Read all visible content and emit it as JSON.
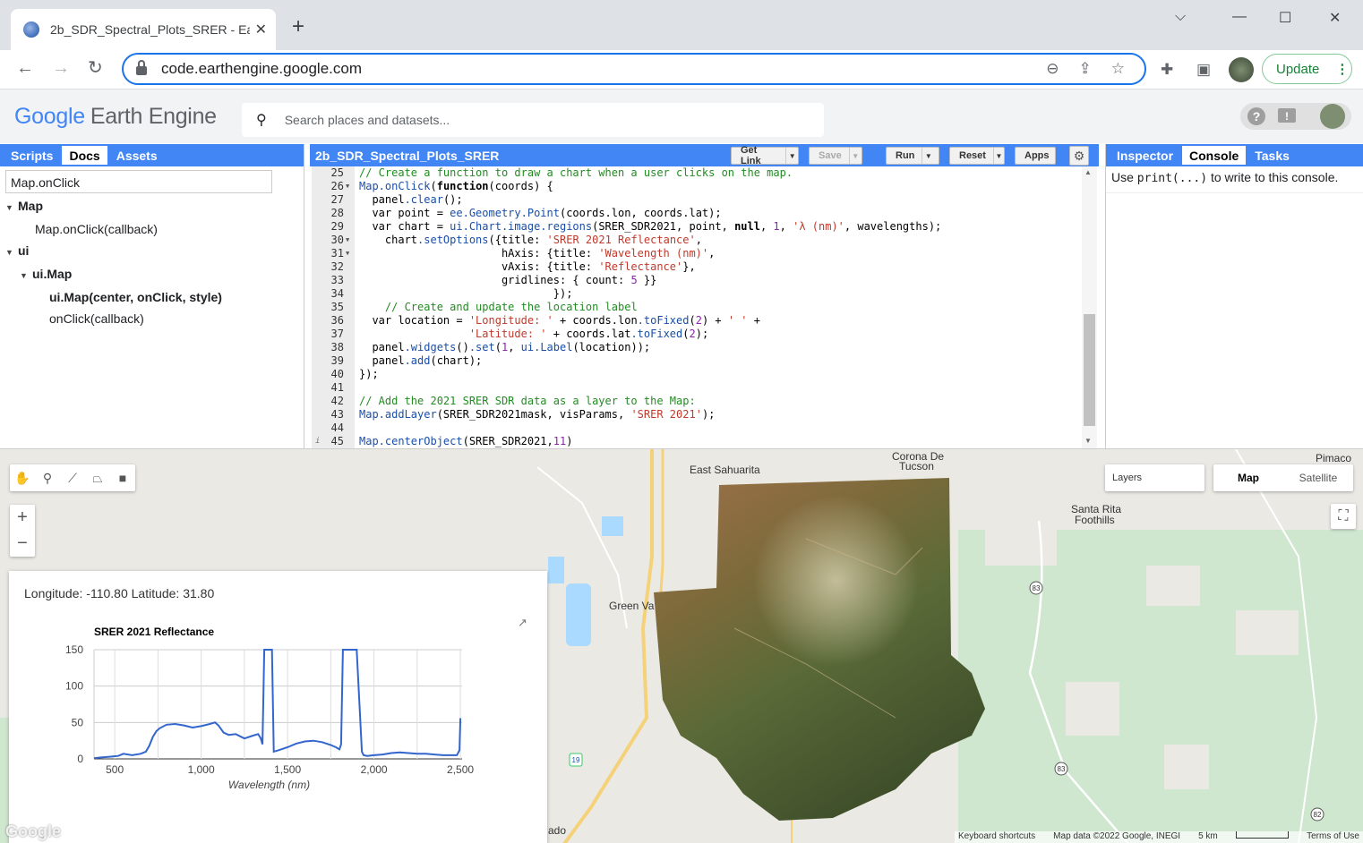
{
  "browser": {
    "tab_title": "2b_SDR_Spectral_Plots_SRER - Ea",
    "url": "code.earthengine.google.com",
    "update_label": "Update"
  },
  "ee": {
    "logo_google": "Google",
    "logo_product": "Earth Engine",
    "search_placeholder": "Search places and datasets..."
  },
  "left_panel": {
    "tabs": [
      "Scripts",
      "Docs",
      "Assets"
    ],
    "active_tab": "Docs",
    "search_value": "Map.onClick",
    "tree": [
      {
        "label": "Map",
        "level": 0,
        "expanded": true,
        "bold": true
      },
      {
        "label": "Map.onClick(callback)",
        "level": 1
      },
      {
        "label": "ui",
        "level": 0,
        "expanded": true,
        "bold": true
      },
      {
        "label": "ui.Map",
        "level": 1,
        "expanded": true,
        "bold": true
      },
      {
        "label": "ui.Map(center, onClick, style)",
        "level": 2,
        "bold": true
      },
      {
        "label": "onClick(callback)",
        "level": 2
      }
    ]
  },
  "editor": {
    "script_name": "2b_SDR_Spectral_Plots_SRER",
    "buttons": [
      "Get Link",
      "Save",
      "Run",
      "Reset",
      "Apps"
    ],
    "lines": [
      {
        "n": "25",
        "code": "// Create a function to draw a chart when a user clicks on the map."
      },
      {
        "n": "26",
        "code": "Map.onClick(function(coords) {",
        "fold": true
      },
      {
        "n": "27",
        "code": "  panel.clear();"
      },
      {
        "n": "28",
        "code": "  var point = ee.Geometry.Point(coords.lon, coords.lat);"
      },
      {
        "n": "29",
        "code": "  var chart = ui.Chart.image.regions(SRER_SDR2021, point, null, 1, 'λ (nm)', wavelengths);"
      },
      {
        "n": "30",
        "code": "    chart.setOptions({title: 'SRER 2021 Reflectance',",
        "fold": true
      },
      {
        "n": "31",
        "code": "                      hAxis: {title: 'Wavelength (nm)',",
        "fold": true
      },
      {
        "n": "32",
        "code": "                      vAxis: {title: 'Reflectance'},"
      },
      {
        "n": "33",
        "code": "                      gridlines: { count: 5 }}"
      },
      {
        "n": "34",
        "code": "                              });"
      },
      {
        "n": "35",
        "code": "    // Create and update the location label"
      },
      {
        "n": "36",
        "code": "  var location = 'Longitude: ' + coords.lon.toFixed(2) + ' ' +"
      },
      {
        "n": "37",
        "code": "                 'Latitude: ' + coords.lat.toFixed(2);"
      },
      {
        "n": "38",
        "code": "  panel.widgets().set(1, ui.Label(location));"
      },
      {
        "n": "39",
        "code": "  panel.add(chart);"
      },
      {
        "n": "40",
        "code": "});"
      },
      {
        "n": "41",
        "code": ""
      },
      {
        "n": "42",
        "code": "// Add the 2021 SRER SDR data as a layer to the Map:"
      },
      {
        "n": "43",
        "code": "Map.addLayer(SRER_SDR2021mask, visParams, 'SRER 2021');"
      },
      {
        "n": "44",
        "code": ""
      },
      {
        "n": "45",
        "code": "Map.centerObject(SRER_SDR2021,11)",
        "info": true
      }
    ]
  },
  "right_panel": {
    "tabs": [
      "Inspector",
      "Console",
      "Tasks"
    ],
    "active_tab": "Console",
    "msg_before": "Use ",
    "msg_code": "print(...)",
    "msg_after": " to write to this console."
  },
  "map": {
    "layers_label": "Layers",
    "map_types": [
      "Map",
      "Satellite"
    ],
    "active_map_type": "Map",
    "place_labels": {
      "east_sahuarita": "East Sahuarita",
      "corona": "Corona De",
      "tucson": "Tucson",
      "pimaco": "Pimaco",
      "santa_rita_1": "Santa Rita",
      "santa_rita_2": "Foothills",
      "green_valley": "Green Va",
      "ado": "ado"
    },
    "road_shields": [
      "83",
      "19",
      "83",
      "82"
    ],
    "google_logo": "Google",
    "attribution": [
      "Keyboard shortcuts",
      "Map data ©2022 Google, INEGI",
      "5 km",
      "Terms of Use"
    ],
    "location_label": "Longitude: -110.80 Latitude: 31.80"
  },
  "chart_data": {
    "type": "line",
    "title": "SRER 2021 Reflectance",
    "xlabel": "Wavelength (nm)",
    "ylabel": "",
    "xlim": [
      380,
      2510
    ],
    "ylim": [
      0,
      150
    ],
    "xticks": [
      500,
      1000,
      1500,
      2000,
      2500
    ],
    "xtick_labels": [
      "500",
      "1,000",
      "1,500",
      "2,000",
      "2,500"
    ],
    "yticks": [
      0,
      50,
      100,
      150
    ],
    "grid": true,
    "color": "#3366cc",
    "x": [
      380,
      420,
      470,
      520,
      550,
      600,
      650,
      680,
      700,
      720,
      740,
      760,
      800,
      850,
      900,
      950,
      1000,
      1050,
      1080,
      1100,
      1130,
      1160,
      1200,
      1250,
      1300,
      1330,
      1345,
      1355,
      1365,
      1400,
      1410,
      1420,
      1450,
      1500,
      1550,
      1600,
      1650,
      1700,
      1750,
      1780,
      1800,
      1810,
      1820,
      1900,
      1930,
      1940,
      1960,
      2000,
      2050,
      2100,
      2150,
      2200,
      2250,
      2300,
      2350,
      2400,
      2450,
      2480,
      2495,
      2500
    ],
    "y": [
      1,
      2,
      3,
      4,
      7,
      5,
      7,
      10,
      18,
      30,
      38,
      42,
      47,
      48,
      46,
      43,
      45,
      48,
      50,
      46,
      36,
      33,
      34,
      28,
      32,
      34,
      28,
      20,
      150,
      150,
      150,
      10,
      12,
      16,
      21,
      24,
      25,
      23,
      19,
      16,
      13,
      20,
      150,
      150,
      10,
      5,
      4,
      5,
      6,
      8,
      9,
      8,
      7,
      7,
      6,
      5,
      5,
      5,
      12,
      56
    ]
  }
}
